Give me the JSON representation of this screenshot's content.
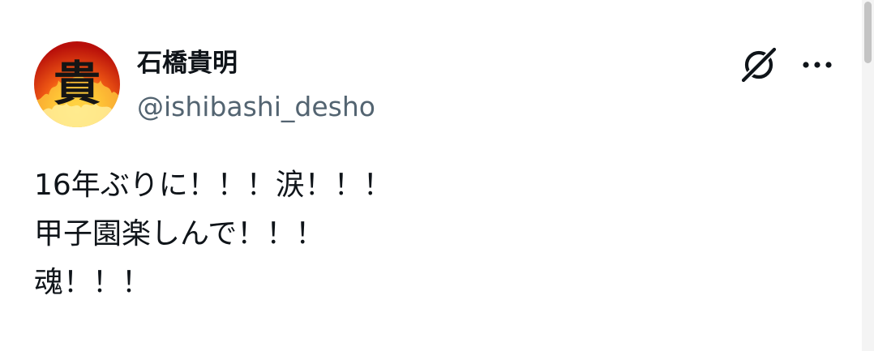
{
  "post": {
    "author": {
      "display_name": "石橋貴明",
      "handle": "@ishibashi_desho",
      "avatar_glyph": "貴",
      "avatar_icon": "flame-kanji-avatar"
    },
    "actions": {
      "grok_icon": "grok-icon",
      "more_icon": "more-options-icon"
    },
    "text_lines": [
      "16年ぶりに！！！涙！！！",
      "甲子園楽しんで！！！",
      "魂！！！"
    ]
  },
  "colors": {
    "text_primary": "#0f1419",
    "text_secondary": "#536471",
    "avatar_fire_outer": "#c0160e",
    "avatar_fire_inner": "#ffcc33"
  }
}
